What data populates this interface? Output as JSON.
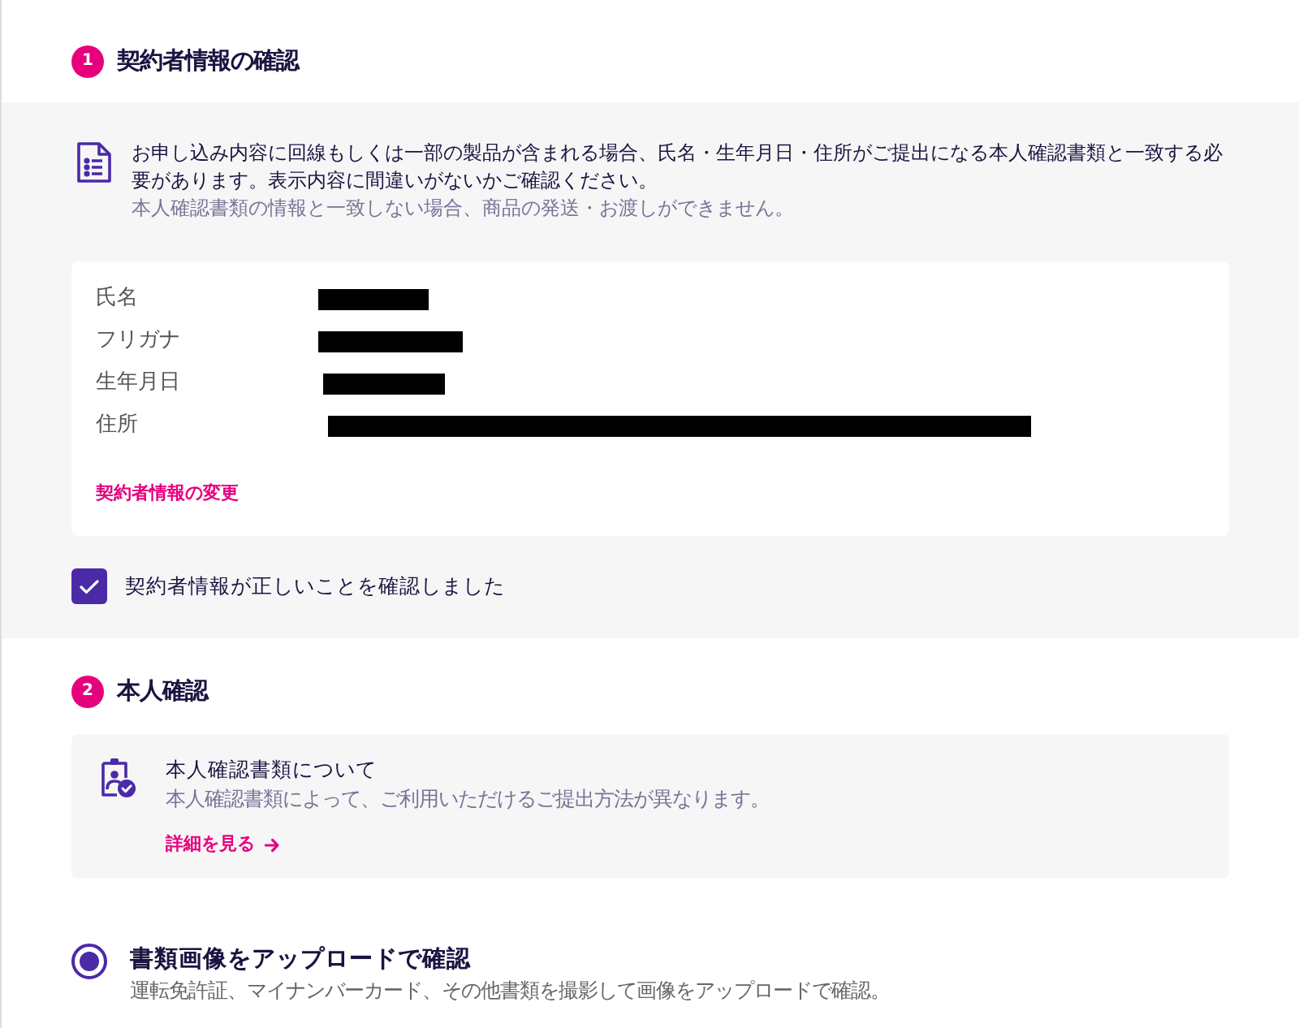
{
  "contractor_section": {
    "step": "1",
    "title": "契約者情報の確認",
    "notice": "お申し込み内容に回線もしくは一部の製品が含まれる場合、氏名・生年月日・住所がご提出になる本人確認書類と一致する必要があります。表示内容に間違いがないかご確認ください。",
    "notice_note": "本人確認書類の情報と一致しない場合、商品の発送・お渡しができません。",
    "fields": [
      {
        "label": "氏名",
        "redacted": true
      },
      {
        "label": "フリガナ",
        "redacted": true
      },
      {
        "label": "生年月日",
        "redacted": true
      },
      {
        "label": "住所",
        "redacted": true
      }
    ],
    "change_link": "契約者情報の変更",
    "confirm_checkbox": {
      "label": "契約者情報が正しいことを確認しました",
      "checked": true
    }
  },
  "identity_section": {
    "step": "2",
    "title": "本人確認",
    "info_card": {
      "title": "本人確認書類について",
      "description": "本人確認書類によって、ご利用いただけるご提出方法が異なります。",
      "link": "詳細を見る"
    },
    "methods": [
      {
        "title": "書類画像をアップロードで確認",
        "description": "運転免許証、マイナンバーカード、その他書類を撮影して画像をアップロードで確認。",
        "selected": true
      }
    ]
  }
}
